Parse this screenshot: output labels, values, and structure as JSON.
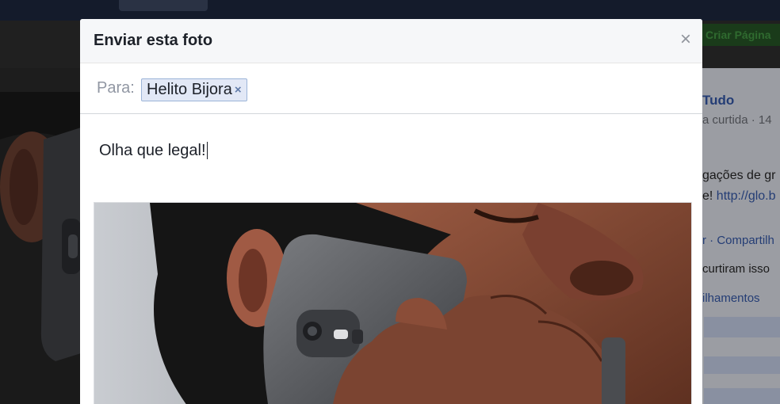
{
  "background": {
    "create_page_label": "Criar Página",
    "panel": {
      "name": "Tudo",
      "meta": "a curtida · 14",
      "line1": "gações de gr",
      "line2_prefix": "e! ",
      "line2_link": "http://glo.b",
      "share": "r · Compartilh",
      "likes": "curtiram isso",
      "shares": "ilhamentos"
    }
  },
  "modal": {
    "title": "Enviar esta foto",
    "close_symbol": "×",
    "to_label": "Para:",
    "recipient": "Helito Bijora",
    "remove_symbol": "×",
    "message": "Olha que legal!"
  }
}
